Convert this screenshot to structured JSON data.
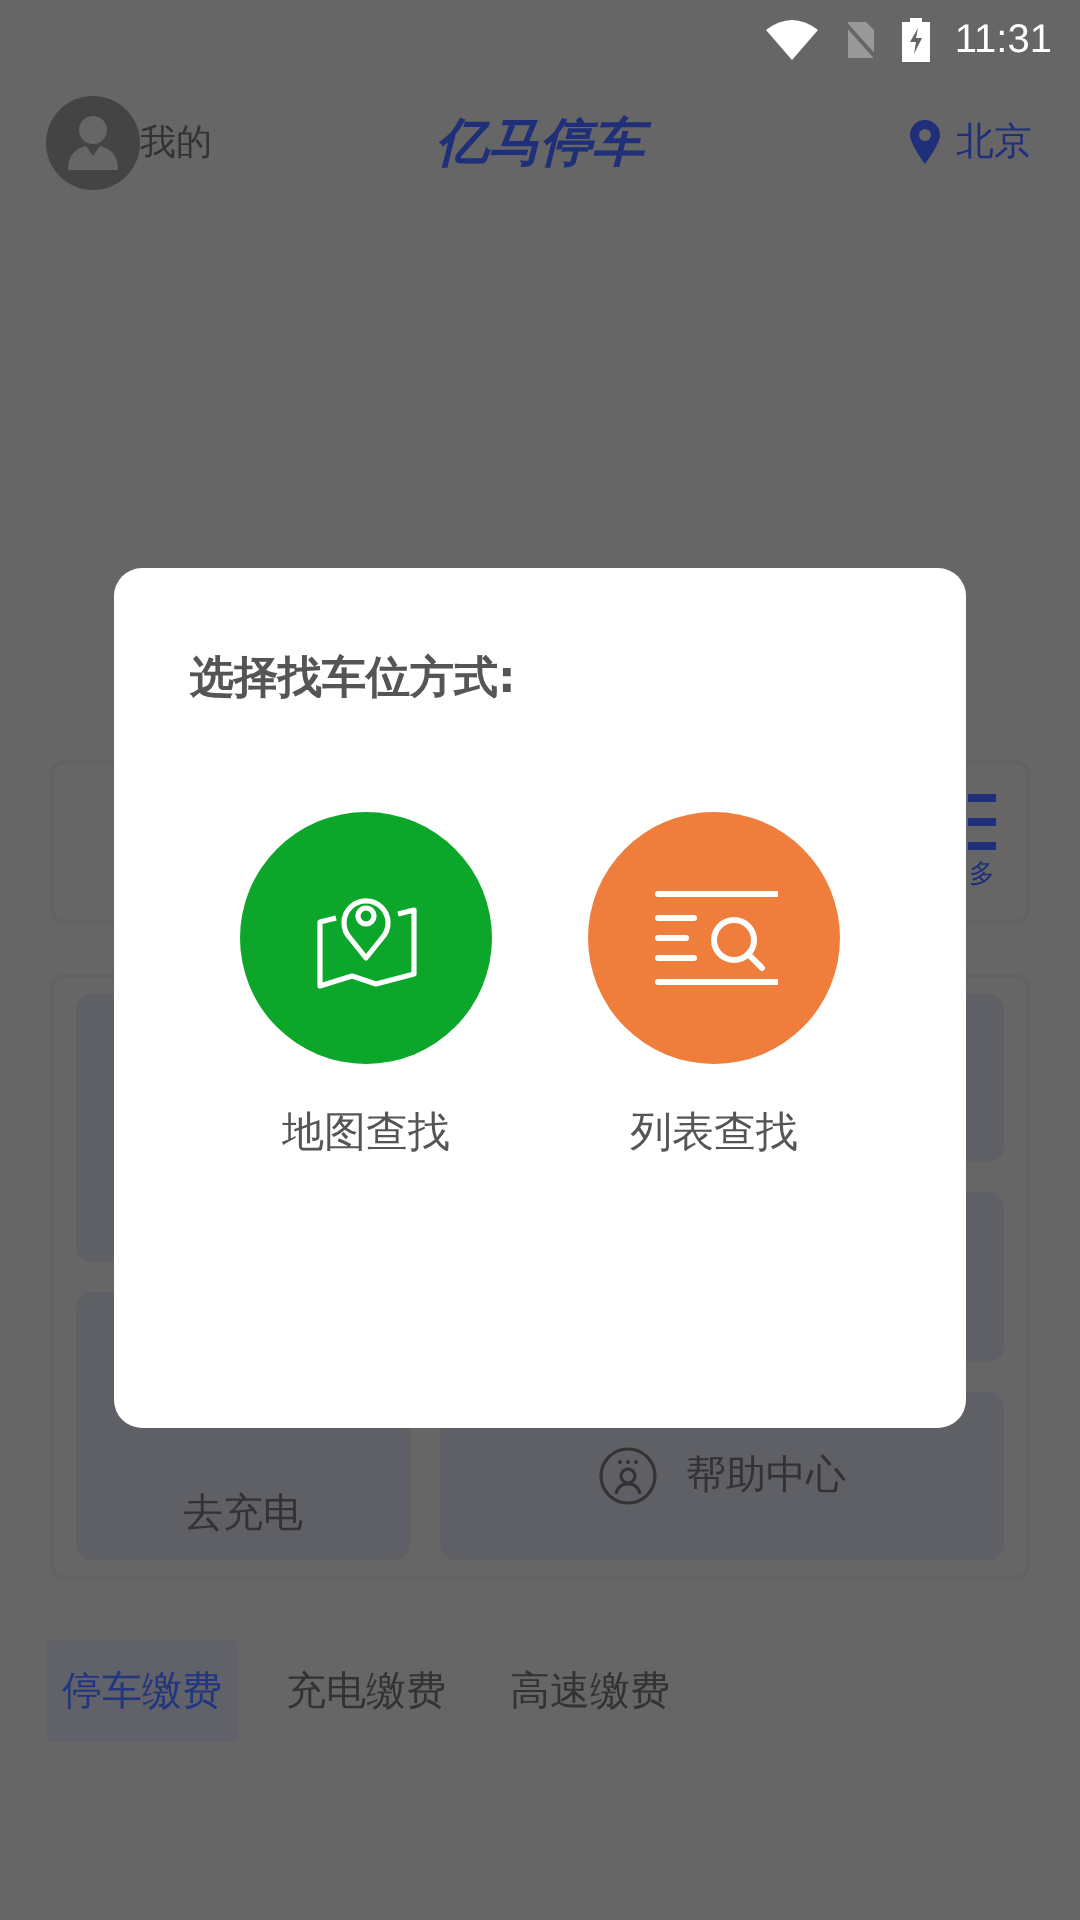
{
  "status_bar": {
    "time": "11:31"
  },
  "header": {
    "profile_label": "我的",
    "title": "亿马停车",
    "city": "北京"
  },
  "service_card": {
    "more_label": "多"
  },
  "tiles": [
    {
      "label": "去充电"
    },
    {
      "label": "帮助中心"
    }
  ],
  "pay_tabs": [
    {
      "label": "停车缴费",
      "selected": true
    },
    {
      "label": "充电缴费",
      "selected": false
    },
    {
      "label": "高速缴费",
      "selected": false
    }
  ],
  "dialog": {
    "title": "选择找车位方式:",
    "options": [
      {
        "kind": "map",
        "label": "地图查找",
        "color": "#0ca72a"
      },
      {
        "kind": "list",
        "label": "列表查找",
        "color": "#ef7d3c"
      }
    ]
  }
}
